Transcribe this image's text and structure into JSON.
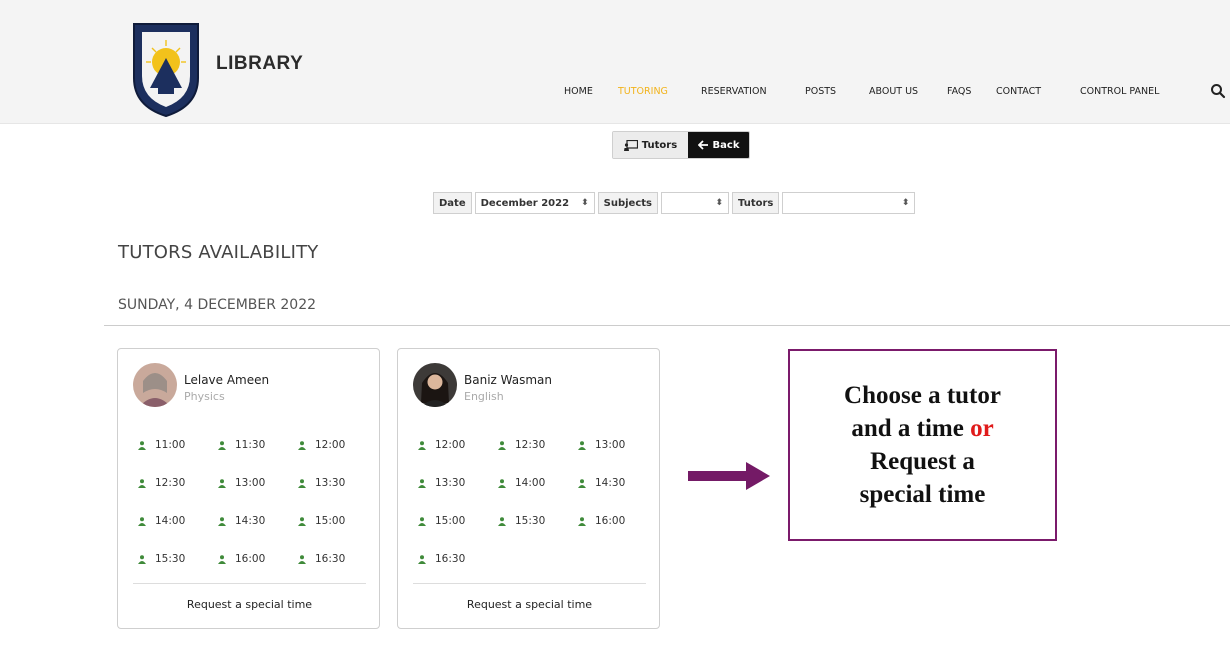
{
  "header": {
    "brand": "LIBRARY",
    "nav": [
      "HOME",
      "TUTORING",
      "RESERVATION",
      "POSTS",
      "ABOUT US",
      "FAQS",
      "CONTACT",
      "CONTROL PANEL"
    ],
    "active_nav": "TUTORING",
    "accent_color": "#f2b31b"
  },
  "toolbar": {
    "tutors_label": "Tutors",
    "back_label": "Back"
  },
  "filters": {
    "date_label": "Date",
    "date_value": "December 2022",
    "subjects_label": "Subjects",
    "subjects_value": "",
    "tutors_label": "Tutors",
    "tutors_value": ""
  },
  "main": {
    "title": "TUTORS AVAILABILITY",
    "date": "SUNDAY, 4 DECEMBER 2022"
  },
  "tutors": [
    {
      "name": "Lelave Ameen",
      "subject": "Physics",
      "slots": [
        "11:00",
        "11:30",
        "12:00",
        "12:30",
        "13:00",
        "13:30",
        "14:00",
        "14:30",
        "15:00",
        "15:30",
        "16:00",
        "16:30"
      ],
      "special_label": "Request a special time"
    },
    {
      "name": "Baniz Wasman",
      "subject": "English",
      "slots": [
        "12:00",
        "12:30",
        "13:00",
        "13:30",
        "14:00",
        "14:30",
        "15:00",
        "15:30",
        "16:00",
        "16:30"
      ],
      "special_label": "Request a special time"
    }
  ],
  "annotation": {
    "line1": "Choose a tutor",
    "line2_a": "and a time ",
    "line2_b": "or",
    "line3": "Request a",
    "line4": "special time",
    "border_color": "#7b1a6b",
    "highlight_color": "#e01b1b"
  },
  "colors": {
    "slot_icon": "#3f8a3a",
    "back_button": "#111111"
  },
  "icons": [
    "university-logo",
    "search-icon",
    "tutors-icon",
    "back-arrow-icon",
    "person-icon",
    "right-arrow-icon"
  ]
}
